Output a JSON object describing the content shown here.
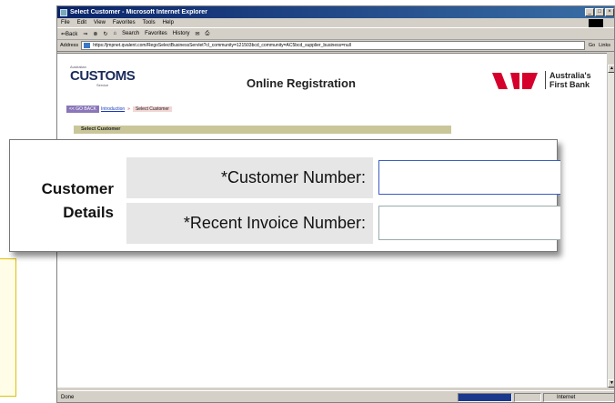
{
  "browser": {
    "title": "Select Customer - Microsoft Internet Explorer",
    "menu": [
      "File",
      "Edit",
      "View",
      "Favorites",
      "Tools",
      "Help"
    ],
    "toolbar": [
      "⇐Back",
      "⇒",
      "Search",
      "Favorites",
      "History"
    ],
    "address_label": "Address",
    "address_url": "https://jmpnet.qvalent.com/RegoSelectBusinessServlet?cl_community=121503bcd_community=AC5bcd_supplier_business=null",
    "go_label": "Go",
    "links_label": "Links",
    "status_text": "Done",
    "zone_text": "Internet"
  },
  "header": {
    "logo_small": "Australian",
    "logo_text": "CUSTOMS",
    "logo_service": "Service",
    "page_title": "Online Registration",
    "bank_name_line1": "Australia's",
    "bank_name_line2": "First Bank",
    "bank_color": "#d5002b"
  },
  "breadcrumb": {
    "back_label": "<< GO BACK",
    "link_label": "Introduction",
    "separator": "»",
    "current_label": "Select Customer"
  },
  "section": {
    "title": "Select Customer"
  },
  "callout": {
    "group_label_line1": "Customer",
    "group_label_line2": "Details",
    "fields": [
      {
        "label": "*Customer Number:",
        "value": ""
      },
      {
        "label": "*Recent Invoice Number:",
        "value": ""
      }
    ]
  }
}
